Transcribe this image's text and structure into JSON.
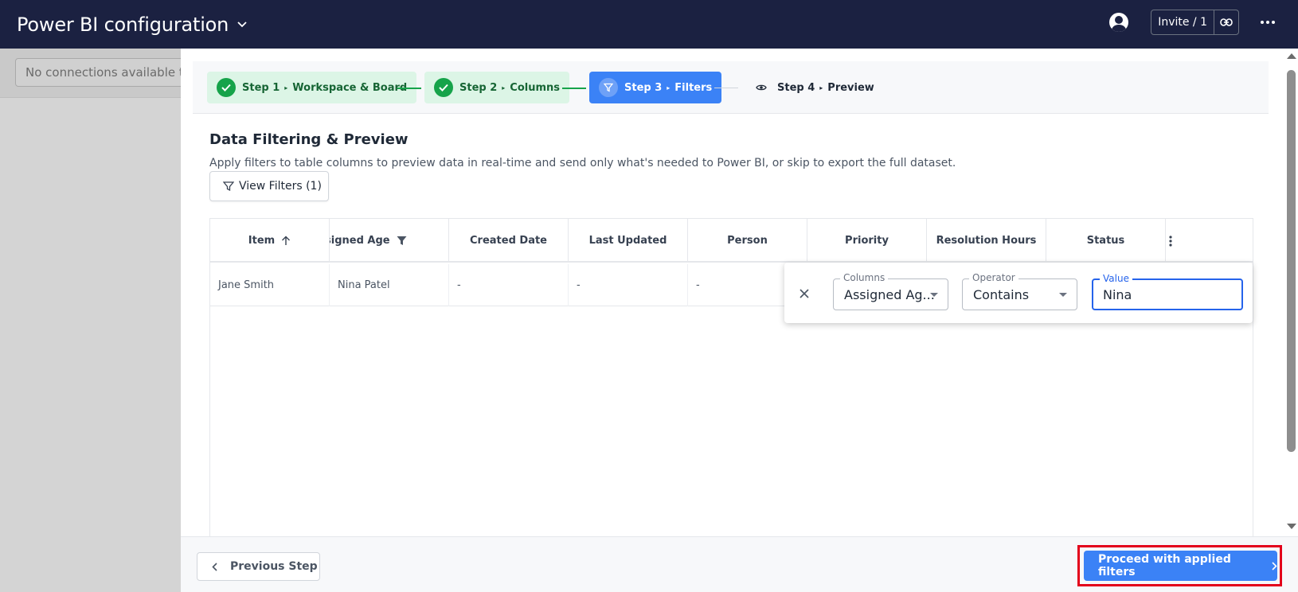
{
  "header": {
    "title": "Power BI configuration",
    "invite_label": "Invite / 1"
  },
  "background": {
    "connection_text": "No connections available to s"
  },
  "stepper": {
    "steps": [
      {
        "number": "Step 1",
        "name": "Workspace & Board",
        "status": "done"
      },
      {
        "number": "Step 2",
        "name": "Columns",
        "status": "done"
      },
      {
        "number": "Step 3",
        "name": "Filters",
        "status": "active"
      },
      {
        "number": "Step 4",
        "name": "Preview",
        "status": "todo"
      }
    ],
    "separator": "▸"
  },
  "section": {
    "title": "Data Filtering & Preview",
    "description": "Apply filters to table columns to preview data in real-time and send only what's needed to Power BI, or skip to export the full dataset.",
    "view_filters_label": "View Filters (1)"
  },
  "table": {
    "columns": [
      "Item",
      "signed Age",
      "Created Date",
      "Last Updated",
      "Person",
      "Priority",
      "Resolution Hours",
      "Status"
    ],
    "rows": [
      [
        "Jane Smith",
        "Nina Patel",
        "-",
        "-",
        "-",
        "",
        "",
        ""
      ]
    ]
  },
  "filter": {
    "columns_label": "Columns",
    "columns_value": "Assigned Ag...",
    "operator_label": "Operator",
    "operator_value": "Contains",
    "value_label": "Value",
    "value_value": "Nina"
  },
  "footer": {
    "previous_label": "Previous Step",
    "proceed_label": "Proceed with applied filters"
  },
  "colors": {
    "topbar": "#1b2141",
    "primary": "#3b82f6",
    "success": "#16a34a",
    "highlight": "#e3001b"
  }
}
